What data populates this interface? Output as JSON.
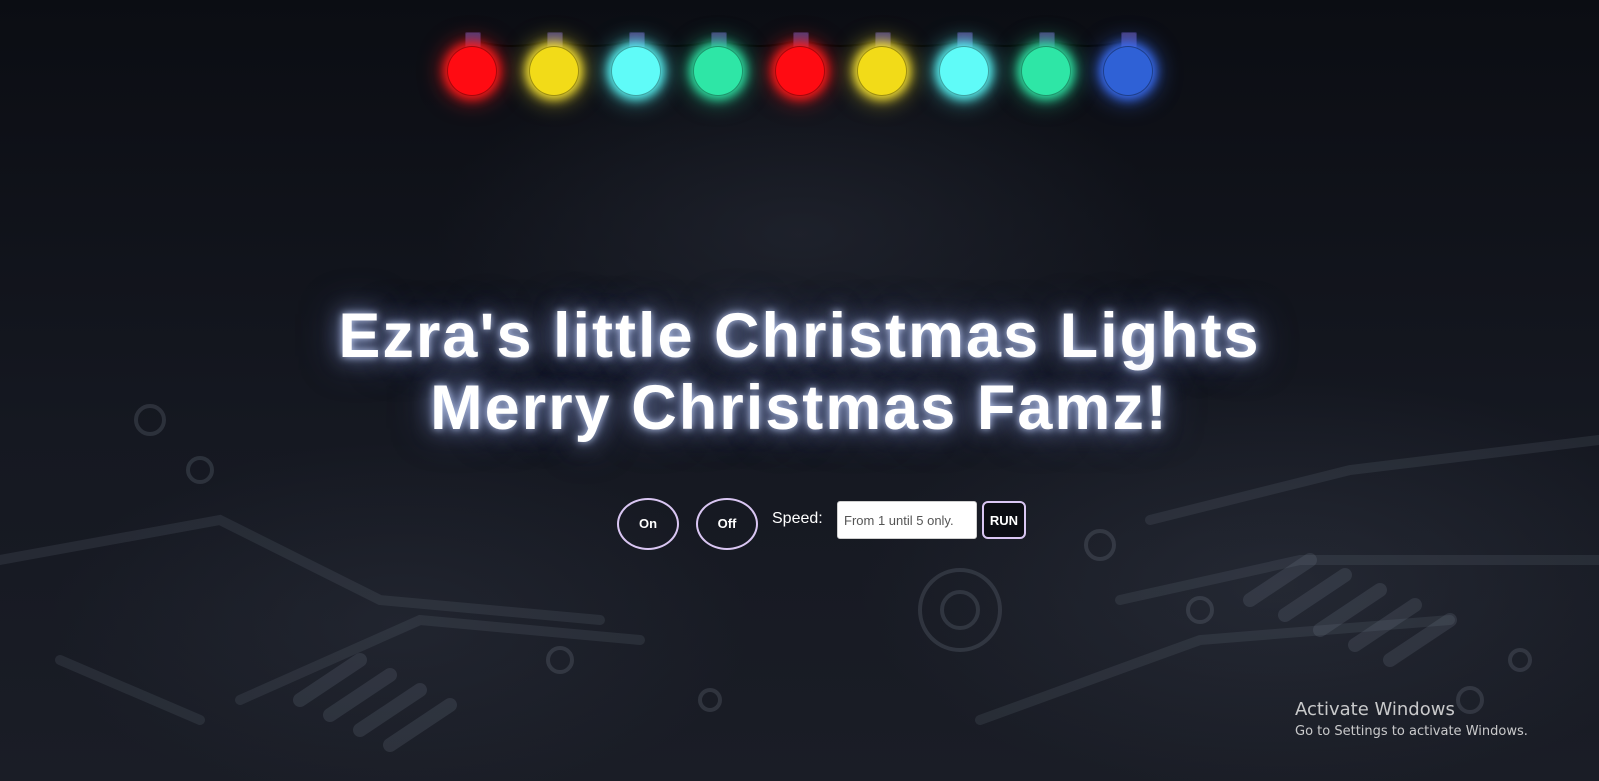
{
  "lights": [
    {
      "color": "#ff0b12",
      "glow": "#ff1a1a"
    },
    {
      "color": "#f2db18",
      "glow": "#f7e233"
    },
    {
      "color": "#5ffbf8",
      "glow": "#58f5f5"
    },
    {
      "color": "#2ee6a6",
      "glow": "#2fe3a4"
    },
    {
      "color": "#ff0b12",
      "glow": "#ff1a1a"
    },
    {
      "color": "#f2db18",
      "glow": "#f7e233"
    },
    {
      "color": "#5ffbf8",
      "glow": "#58f5f5"
    },
    {
      "color": "#2ee6a6",
      "glow": "#2fe3a4"
    },
    {
      "color": "#2f61d6",
      "glow": "#3a6ef5"
    }
  ],
  "title": {
    "line1": "Ezra's little Christmas Lights",
    "line2": "Merry Christmas Famz!"
  },
  "controls": {
    "on_label": "On",
    "off_label": "Off",
    "speed_label": "Speed:",
    "speed_placeholder": "From 1 until 5 only.",
    "run_label": "RUN"
  },
  "watermark": {
    "title": "Activate Windows",
    "subtitle": "Go to Settings to activate Windows."
  },
  "colors": {
    "background": "#0c0f16",
    "button_border": "#d9c6f2",
    "text": "#ffffff"
  }
}
